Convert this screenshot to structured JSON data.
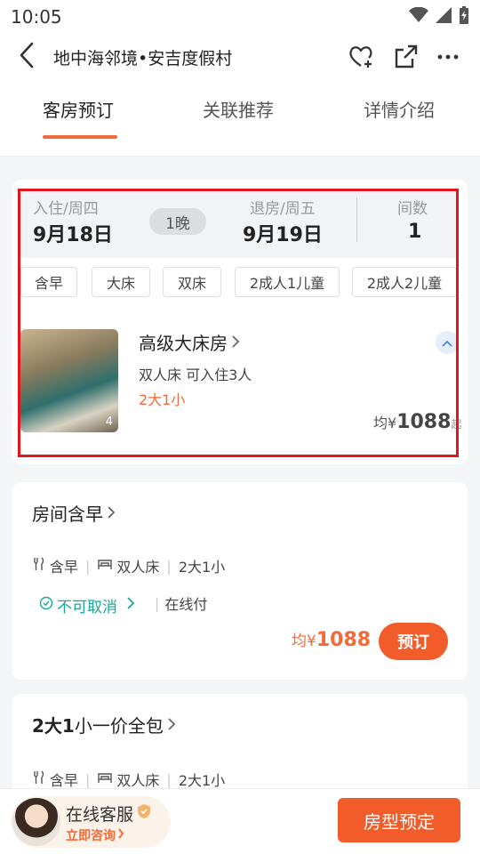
{
  "status_bar": {
    "time": "10:05"
  },
  "nav": {
    "title": "地中海邻境•安吉度假村"
  },
  "tabs": [
    {
      "label": "客房预订",
      "active": true
    },
    {
      "label": "关联推荐",
      "active": false
    },
    {
      "label": "详情介绍",
      "active": false
    }
  ],
  "stay": {
    "checkin_label": "入住/周四",
    "checkin_date": "9月18日",
    "nights": "1晚",
    "checkout_label": "退房/周五",
    "checkout_date": "9月19日",
    "rooms_label": "间数",
    "rooms_value": "1"
  },
  "filters": [
    "含早",
    "大床",
    "双床",
    "2成人1儿童",
    "2成人2儿童"
  ],
  "room": {
    "name": "高级大床房",
    "bed": "双人床 可入住3人",
    "occupancy": "2大1小",
    "image_count": "4",
    "price_prefix": "均¥",
    "price": "1088",
    "price_suffix": "起"
  },
  "plans": [
    {
      "title": "房间含早",
      "breakfast": "含早",
      "bed": "双人床",
      "occupancy": "2大1小",
      "cancel": "不可取消",
      "payment": "在线付",
      "price_prefix": "均¥",
      "price": "1088",
      "book_label": "预订"
    },
    {
      "title_bold": "2大1",
      "title_rest": "小一价全包",
      "breakfast": "含早",
      "bed": "双人床",
      "occupancy": "2大1小"
    }
  ],
  "bottom": {
    "cs_title": "在线客服",
    "cs_link": "立即咨询",
    "room_book": "房型预定"
  },
  "colors": {
    "accent": "#f25b2a",
    "cancel_green": "#19a79a",
    "highlight": "#e2161c"
  }
}
